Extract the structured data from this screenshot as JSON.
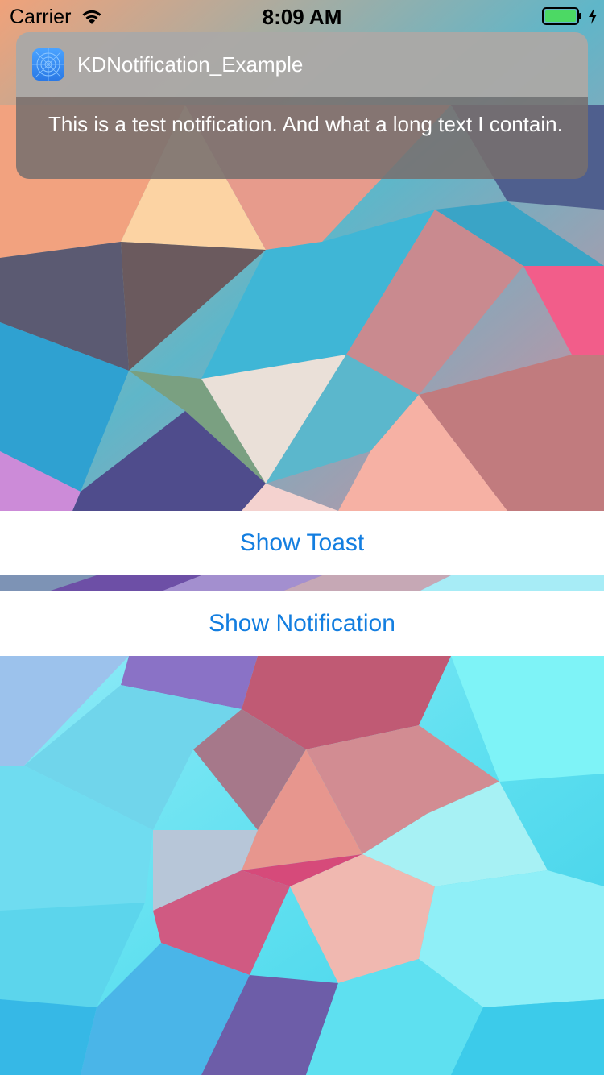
{
  "status_bar": {
    "carrier": "Carrier",
    "time": "8:09 AM",
    "wifi_icon": "wifi-icon",
    "battery_icon": "battery-icon",
    "charging_icon": "charging-bolt-icon",
    "battery_color": "#4cd964"
  },
  "notification": {
    "app_icon": "app-icon",
    "app_name": "KDNotification_Example",
    "message": "This is a test notification. And what a long text I contain."
  },
  "actions": {
    "show_toast_label": "Show Toast",
    "show_notification_label": "Show Notification"
  },
  "colors": {
    "tint": "#137ee0",
    "button_background": "#ffffff"
  }
}
